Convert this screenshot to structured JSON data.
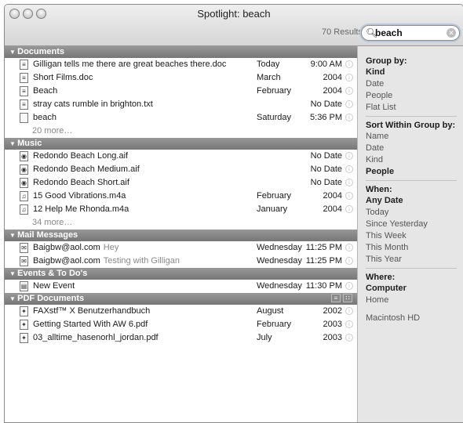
{
  "window": {
    "title": "Spotlight: beach",
    "results_label": "70 Results"
  },
  "search": {
    "value": "beach"
  },
  "categories": [
    {
      "name": "Documents",
      "rows": [
        {
          "icon": "doc-file-icon",
          "name": "Gilligan tells me there are great beaches there.doc",
          "sub": "",
          "date": "Today",
          "time": "9:00 AM"
        },
        {
          "icon": "doc-file-icon",
          "name": "Short Films.doc",
          "sub": "",
          "date": "March",
          "time": "2004"
        },
        {
          "icon": "doc-file-icon",
          "name": "Beach",
          "sub": "",
          "date": "February",
          "time": "2004"
        },
        {
          "icon": "text-file-icon",
          "name": "stray cats rumble in brighton.txt",
          "sub": "",
          "date": "",
          "time": "No Date"
        },
        {
          "icon": "blank-file-icon",
          "name": "beach",
          "sub": "",
          "date": "Saturday",
          "time": "5:36 PM"
        }
      ],
      "more": "20 more…"
    },
    {
      "name": "Music",
      "rows": [
        {
          "icon": "audio-file-icon",
          "name": "Redondo Beach Long.aif",
          "sub": "",
          "date": "",
          "time": "No Date"
        },
        {
          "icon": "audio-file-icon",
          "name": "Redondo Beach Medium.aif",
          "sub": "",
          "date": "",
          "time": "No Date"
        },
        {
          "icon": "audio-file-icon",
          "name": "Redondo Beach Short.aif",
          "sub": "",
          "date": "",
          "time": "No Date"
        },
        {
          "icon": "music-file-icon",
          "name": "15 Good Vibrations.m4a",
          "sub": "",
          "date": "February",
          "time": "2004"
        },
        {
          "icon": "music-file-icon",
          "name": "12 Help Me Rhonda.m4a",
          "sub": "",
          "date": "January",
          "time": "2004"
        }
      ],
      "more": "34 more…"
    },
    {
      "name": "Mail Messages",
      "rows": [
        {
          "icon": "mail-icon",
          "name": "Baigbw@aol.com",
          "sub": "Hey",
          "date": "Wednesday",
          "time": "11:25 PM"
        },
        {
          "icon": "mail-icon",
          "name": "Baigbw@aol.com",
          "sub": "Testing with Gilligan",
          "date": "Wednesday",
          "time": "11:25 PM"
        }
      ],
      "more": ""
    },
    {
      "name": "Events & To Do's",
      "rows": [
        {
          "icon": "calendar-event-icon",
          "name": "New Event",
          "sub": "",
          "date": "Wednesday",
          "time": "11:30 PM"
        }
      ],
      "more": ""
    },
    {
      "name": "PDF Documents",
      "rows": [
        {
          "icon": "pdf-file-icon",
          "name": "FAXstf™ X Benutzerhandbuch",
          "sub": "",
          "date": "August",
          "time": "2002"
        },
        {
          "icon": "pdf-file-icon",
          "name": "Getting Started With AW 6.pdf",
          "sub": "",
          "date": "February",
          "time": "2003"
        },
        {
          "icon": "pdf-file-icon",
          "name": "03_alltime_hasenorhl_jordan.pdf",
          "sub": "",
          "date": "July",
          "time": "2003"
        }
      ],
      "more": "",
      "has_view_buttons": true
    }
  ],
  "sidebar": {
    "sections": [
      {
        "heading": "Group by:",
        "items": [
          {
            "label": "Kind",
            "selected": true
          },
          {
            "label": "Date",
            "selected": false
          },
          {
            "label": "People",
            "selected": false
          },
          {
            "label": "Flat List",
            "selected": false
          }
        ]
      },
      {
        "heading": "Sort Within Group by:",
        "items": [
          {
            "label": "Name",
            "selected": false
          },
          {
            "label": "Date",
            "selected": false
          },
          {
            "label": "Kind",
            "selected": false
          },
          {
            "label": "People",
            "selected": true
          }
        ]
      },
      {
        "heading": "When:",
        "items": [
          {
            "label": "Any Date",
            "selected": true
          },
          {
            "label": "Today",
            "selected": false
          },
          {
            "label": "Since Yesterday",
            "selected": false
          },
          {
            "label": "This Week",
            "selected": false
          },
          {
            "label": "This Month",
            "selected": false
          },
          {
            "label": "This Year",
            "selected": false
          }
        ]
      },
      {
        "heading": "Where:",
        "items": [
          {
            "label": "Computer",
            "selected": true
          },
          {
            "label": "Home",
            "selected": false
          },
          {
            "label": "Macintosh HD",
            "selected": false
          }
        ]
      }
    ]
  }
}
